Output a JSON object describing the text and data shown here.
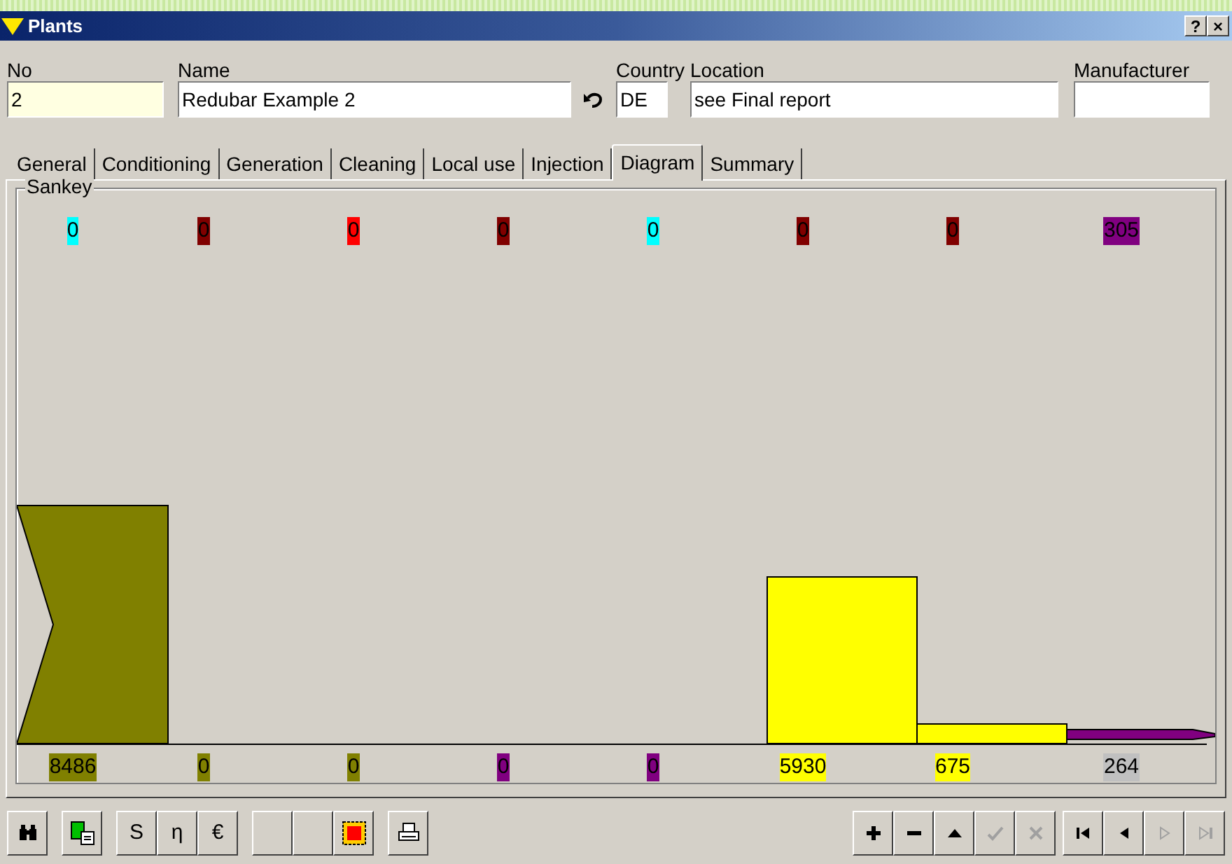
{
  "window": {
    "title": "Plants",
    "buttons": [
      "?",
      "×"
    ]
  },
  "fields": [
    {
      "label": "No",
      "value": "2",
      "kind": "highlight"
    },
    {
      "label": "Name",
      "value": "Redubar Example 2",
      "kind": "text"
    },
    {
      "label": "Country",
      "value": "DE",
      "kind": "text"
    },
    {
      "label": "Location",
      "value": "see Final report",
      "kind": "text"
    },
    {
      "label": "Manufacturer",
      "kind": "text"
    }
  ],
  "tabs": [
    {
      "label": "General",
      "selected": false
    },
    {
      "label": "Conditioning",
      "selected": false
    },
    {
      "label": "Generation",
      "selected": false
    },
    {
      "label": "Cleaning",
      "selected": false
    },
    {
      "label": "Local use",
      "selected": false
    },
    {
      "label": "Injection",
      "selected": false
    },
    {
      "label": "Diagram",
      "selected": true
    },
    {
      "label": "Summary",
      "selected": false
    }
  ],
  "sankey": {
    "title": "Sankey",
    "top_values": [
      {
        "text": "0",
        "color": "#00ffff"
      },
      {
        "text": "0",
        "color": "#800000"
      },
      {
        "text": "0",
        "color": "#ff0000"
      },
      {
        "text": "0",
        "color": "#800000"
      },
      {
        "text": "0",
        "color": "#00ffff"
      },
      {
        "text": "0",
        "color": "#800000"
      },
      {
        "text": "0",
        "color": "#800000"
      },
      {
        "text": "305",
        "color": "#800080"
      }
    ],
    "bottom_values": [
      {
        "text": "8486",
        "color": "#808000"
      },
      {
        "text": "0",
        "color": "#808000"
      },
      {
        "text": "0",
        "color": "#808000"
      },
      {
        "text": "0",
        "color": "#800080"
      },
      {
        "text": "0",
        "color": "#800080"
      },
      {
        "text": "5930",
        "color": "#ffff00"
      },
      {
        "text": "675",
        "color": "#ffff00"
      },
      {
        "text": "264",
        "color": "#c0c0c0"
      }
    ]
  },
  "toolbar_left": [
    {
      "kind": "binoculars"
    },
    {
      "kind": "report"
    },
    {
      "kind": "text",
      "text": "S"
    },
    {
      "kind": "text",
      "text": "η"
    },
    {
      "kind": "text",
      "text": "€"
    },
    {
      "kind": "blank"
    },
    {
      "kind": "blank"
    },
    {
      "kind": "frame"
    },
    {
      "kind": "print"
    }
  ],
  "toolbar_right": [
    {
      "kind": "plus",
      "disabled": false
    },
    {
      "kind": "minus",
      "disabled": false
    },
    {
      "kind": "up",
      "disabled": false
    },
    {
      "kind": "check",
      "disabled": true
    },
    {
      "kind": "cancel",
      "disabled": true
    },
    {
      "kind": "first",
      "disabled": false
    },
    {
      "kind": "prev",
      "disabled": false
    },
    {
      "kind": "next",
      "disabled": true
    },
    {
      "kind": "last",
      "disabled": true
    }
  ]
}
